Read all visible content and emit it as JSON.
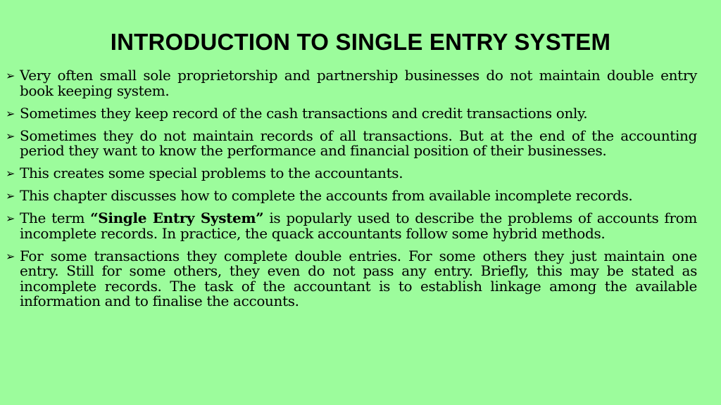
{
  "slide": {
    "background_color": "#9cfc9c",
    "title": "INTRODUCTION TO SINGLE ENTRY SYSTEM",
    "bullet_icon": "arrowhead-bullet",
    "bullet_glyph": "➢",
    "points": [
      {
        "text": "Very often small sole proprietorship and partnership businesses do not maintain double entry book keeping system."
      },
      {
        "text": "Sometimes they keep record of the cash transactions and credit transactions only."
      },
      {
        "text": "Sometimes they do not maintain records of all transactions. But at the end of the accounting period they want to know the performance and financial position of their businesses."
      },
      {
        "text": "This creates some special problems to the accountants."
      },
      {
        "text": "This chapter discusses how to complete the accounts from available incomplete records."
      },
      {
        "before": "The term ",
        "bold": "“Single Entry System”",
        "after": " is popularly used to describe the problems of accounts from incomplete records. In practice, the quack accountants follow some hybrid methods."
      },
      {
        "text": "For some transactions they complete double entries. For some others they just maintain one entry. Still for some others, they even do not pass any entry. Briefly, this may be stated as incomplete records. The task of the accountant is to establish linkage among the available information and to finalise the accounts."
      }
    ]
  }
}
